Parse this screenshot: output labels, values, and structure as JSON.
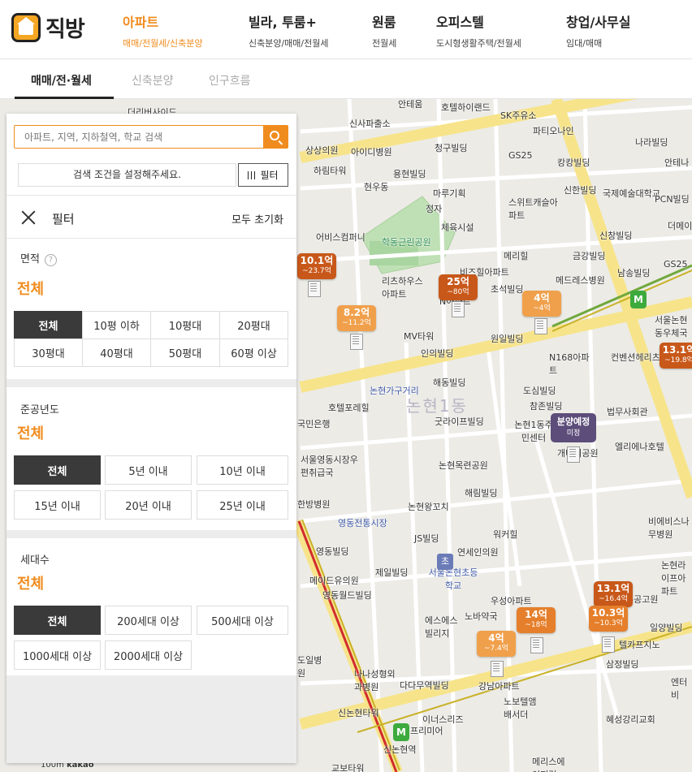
{
  "logo": {
    "text": "직방"
  },
  "nav": [
    {
      "title": "아파트",
      "sub": "매매/전월세/신축분양",
      "active": true
    },
    {
      "title": "빌라, 투룸+",
      "sub": "신축분양/매매/전월세"
    },
    {
      "title": "원룸",
      "sub": "전월세"
    },
    {
      "title": "오피스텔",
      "sub": "도시형생활주택/전월세"
    },
    {
      "title": "창업/사무실",
      "sub": "임대/매매"
    }
  ],
  "tabs": [
    "매매/전·월세",
    "신축분양",
    "인구흐름"
  ],
  "search": {
    "placeholder": "아파트, 지역, 지하철역, 학교 검색"
  },
  "condition_text": "검색 조건을 설정해주세요.",
  "filter_button": "필터",
  "filter_header": {
    "title": "필터",
    "reset": "모두 초기화"
  },
  "area": {
    "label": "면적",
    "help": "?",
    "value": "전체",
    "options": [
      "전체",
      "10평 이하",
      "10평대",
      "20평대",
      "30평대",
      "40평대",
      "50평대",
      "60평 이상"
    ]
  },
  "built_year": {
    "label": "준공년도",
    "value": "전체",
    "options": [
      "전체",
      "5년 이내",
      "10년 이내",
      "15년 이내",
      "20년 이내",
      "25년 이내"
    ]
  },
  "households": {
    "label": "세대수",
    "value": "전체",
    "options": [
      "전체",
      "200세대 이상",
      "500세대 이상",
      "1000세대 이상",
      "2000세대 이상"
    ]
  },
  "map": {
    "labels": [
      "더리버사이드",
      "신사파출소",
      "안테움",
      "호텔하이랜드",
      "SK주유소",
      "파티오나인",
      "상상의원",
      "아이디병원",
      "청구빌딩",
      "GS25",
      "캉캉빌딩",
      "나라빌딩",
      "하림타워",
      "용현빌딩",
      "현우동",
      "마루기획",
      "신한빌딩",
      "국제예술대학교",
      "안테나",
      "PCN빌딩",
      "정자",
      "스위트캐슬아파트",
      "체육시설",
      "더메이",
      "어비스컴퍼니",
      "학동근린공원",
      "신창빌딩",
      "메리힐",
      "금강빌딩",
      "GS25",
      "남송빌딩",
      "리츠하우스아파트",
      "비즈힐아파트",
      "메드레스병원",
      "N아파트",
      "초석빌딩",
      "원일빌딩",
      "서울논현동우체국",
      "MV타워",
      "인의빌딩",
      "N168아파트",
      "컨벤션헤리츠",
      "해동빌딩",
      "도심빌딩",
      "논현가구거리",
      "논현1동",
      "호텔포레힐",
      "참존빌딩",
      "법무사회관",
      "굿라이프빌딩",
      "국민은행",
      "논현1동주민센터",
      "개나리공원",
      "엘리에나호텔",
      "서울영동시장우편취급국",
      "논현목련공원",
      "해림빌딩",
      "한방병원",
      "논현왕꼬치",
      "영동전통시장",
      "비에비스나무병원",
      "JS빌딩",
      "워커힐",
      "영동빌딩",
      "연세인의원",
      "메이드유의원",
      "서울논현초등학교",
      "제일빌딩",
      "논현라이프아파트",
      "영동월드빌딩",
      "우성아파트",
      "에스에스빌리지",
      "노바약국",
      "일양빌딩",
      "주공고원",
      "텔카프지노",
      "도일병원",
      "나나성형외과병원",
      "다다무역빌딩",
      "강남아파트",
      "삼정빌딩",
      "신논현타워",
      "노보텔앰배서더",
      "엔터비",
      "이너스리즈",
      "프리미어",
      "혜성강리교회",
      "교보타워",
      "메리스에이퍼런",
      "신논현역"
    ],
    "prices": [
      {
        "main": "10.1억",
        "sub": "~23.7억"
      },
      {
        "main": "8.2억",
        "sub": "~11.2억"
      },
      {
        "main": "25억",
        "sub": "~80억"
      },
      {
        "main": "4억",
        "sub": "~4억"
      },
      {
        "main": "13.1억",
        "sub": "~19.8억"
      },
      {
        "main": "13.1억",
        "sub": "~16.4억"
      },
      {
        "main": "10.3억",
        "sub": "~10.3억"
      },
      {
        "main": "14억",
        "sub": "~18억"
      },
      {
        "main": "4억",
        "sub": "~7.4억"
      }
    ],
    "presale": {
      "main": "분양예정",
      "sub": "미정"
    },
    "school_glyph": "초",
    "subway_glyph": "M",
    "scale": "100m",
    "attribution": "kakao"
  }
}
